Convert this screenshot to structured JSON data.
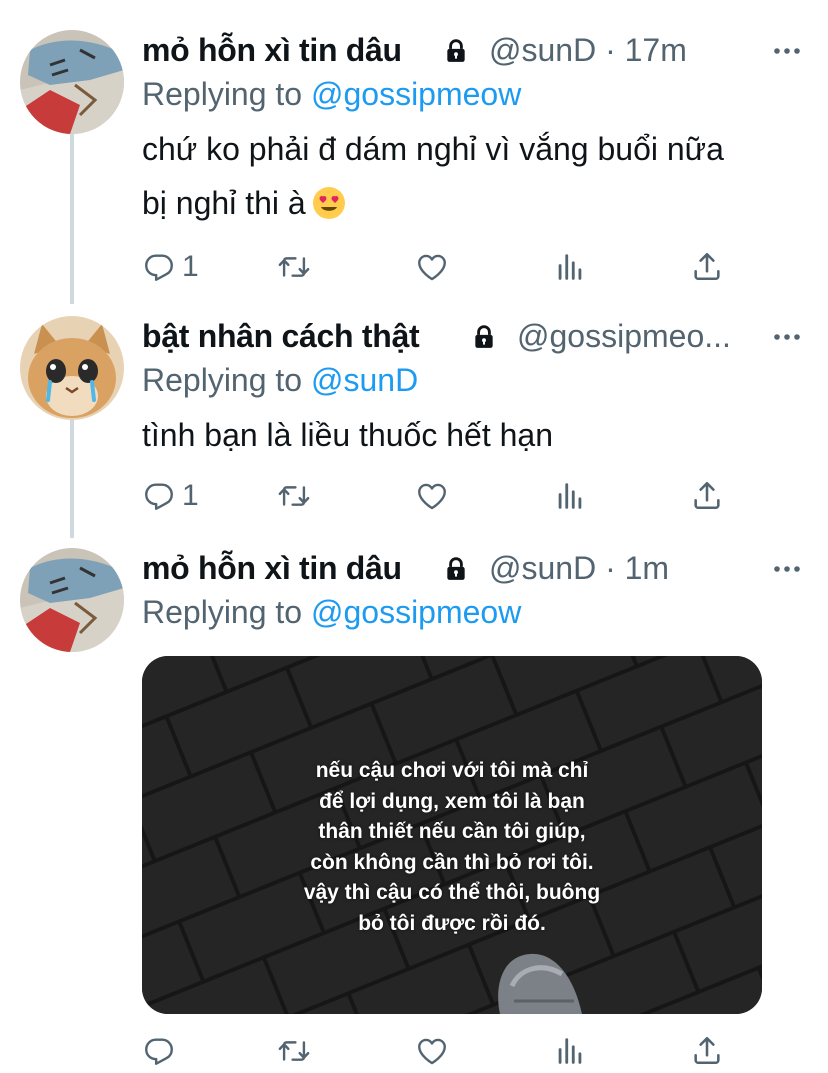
{
  "colors": {
    "text_primary": "#0f1419",
    "text_secondary": "#536471",
    "link_blue": "#1d9bf0",
    "thread_line": "#cfd9de"
  },
  "tweets": [
    {
      "display_name": "mỏ hỗn xì tin dâu",
      "handle_time": "@sunD · 17m",
      "reply_prefix": "Replying to",
      "reply_to": "@gossipmeow",
      "text_lines": [
        "chứ ko phải đ dám nghỉ vì vắng buổi nữa",
        "bị nghỉ thi à"
      ],
      "emoji": "heart-eyes-emoji",
      "reply_count": "1",
      "icons": [
        "lock-icon",
        "more-icon",
        "reply-icon",
        "retweet-icon",
        "like-icon",
        "analytics-icon",
        "share-icon"
      ]
    },
    {
      "display_name": "bật nhân cách thật",
      "handle_time": "@gossipmeo...",
      "reply_prefix": "Replying to",
      "reply_to": "@sunD",
      "text_lines": [
        "tình bạn là liều thuốc hết hạn"
      ],
      "reply_count": "1"
    },
    {
      "display_name": "mỏ hỗn xì tin dâu",
      "handle_time": "@sunD · 1m",
      "reply_prefix": "Replying to",
      "reply_to": "@gossipmeow",
      "media_caption": [
        "nếu cậu chơi với tôi mà chỉ",
        "để lợi dụng, xem tôi là bạn",
        "thân thiết nếu cần tôi giúp,",
        "còn không cần thì bỏ rơi tôi.",
        "vậy thì cậu có thể thôi, buông",
        "bỏ tôi được rồi đó."
      ],
      "reply_count": ""
    }
  ]
}
